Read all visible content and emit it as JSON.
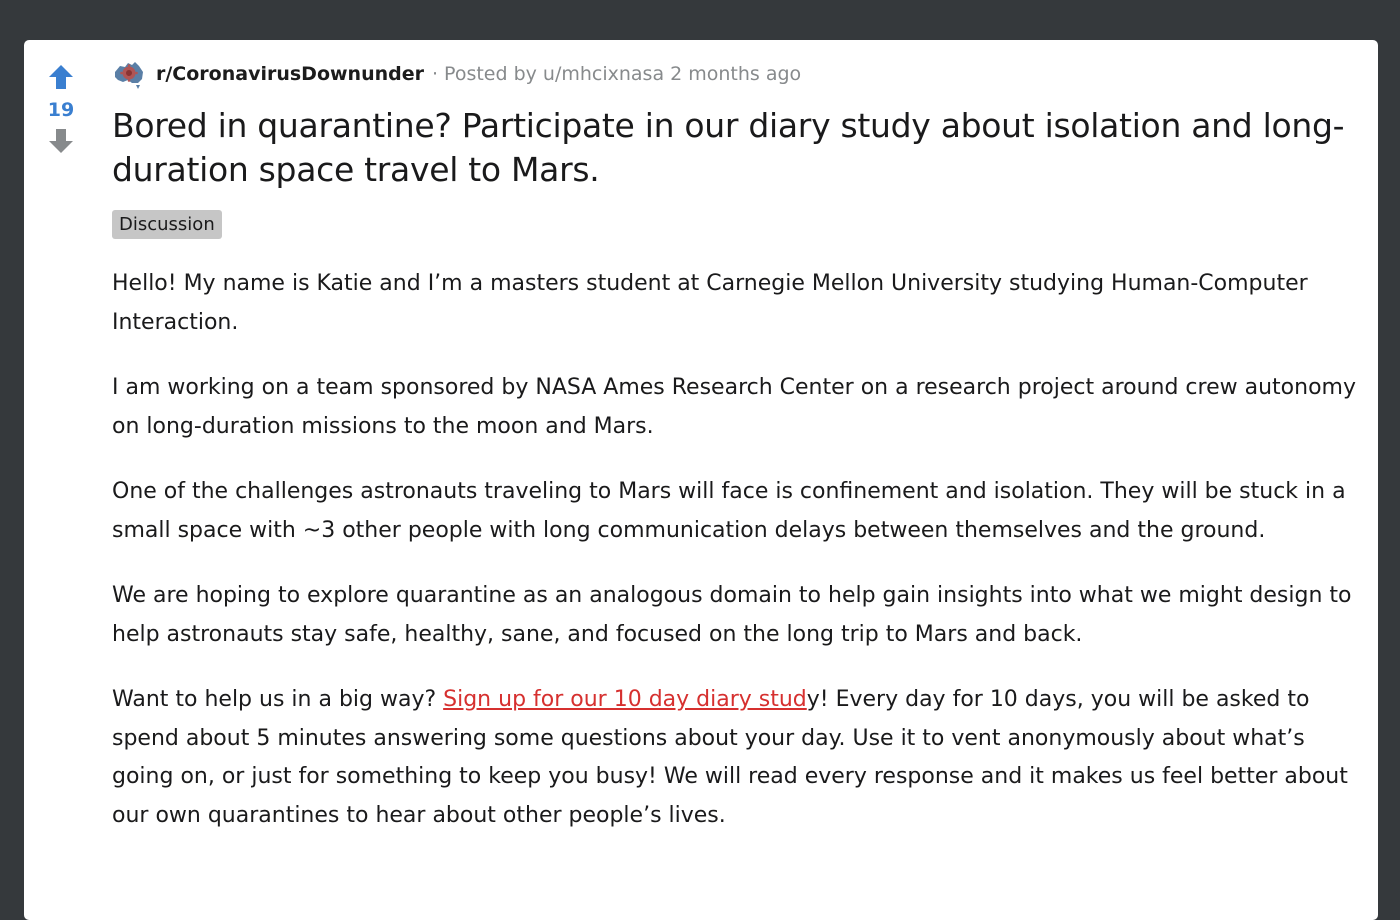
{
  "post": {
    "score": "19",
    "subreddit": "r/CoronavirusDownunder",
    "separator": "·",
    "posted_by_prefix": "Posted by",
    "author": "u/mhcixnasa",
    "time_ago": "2 months ago",
    "title": "Bored in quarantine? Participate in our diary study about isolation and long-duration space travel to Mars.",
    "flair": "Discussion",
    "paragraphs": [
      "Hello! My name is Katie and I’m a masters student at Carnegie Mellon University studying Human-Computer Interaction.",
      "I am working on a team sponsored by NASA Ames Research Center on a research project around crew autonomy on long-duration missions to the moon and Mars.",
      "One of the challenges astronauts traveling to Mars will face is confinement and isolation. They will be stuck in a small space with ~3 other people with long communication delays between themselves and the ground.",
      "We are hoping to explore quarantine as an analogous domain to help gain insights into what we might design to help astronauts stay safe, healthy, sane, and focused on the long trip to Mars and back."
    ],
    "last_paragraph": {
      "before_link": "Want to help us in a big way? ",
      "link_text": "Sign up for our 10 day diary stud",
      "after_link": "y! Every day for 10 days, you will be asked to spend about 5 minutes answering some questions about your day. Use it to vent anonymously about what’s going on, or just for something to keep you busy! We will read every response and it makes us feel better about our own quarantines to hear about other people’s lives."
    }
  },
  "colors": {
    "background": "#35393c",
    "card": "#ffffff",
    "score": "#3a7fd0",
    "upvote_arrow": "#3a7fd0",
    "downvote_arrow": "#878a8c",
    "link": "#d6302f",
    "flair_bg": "#c6c6c6"
  },
  "icons": {
    "upvote": "upvote-arrow-icon",
    "downvote": "downvote-arrow-icon",
    "subreddit": "subreddit-map-icon"
  }
}
